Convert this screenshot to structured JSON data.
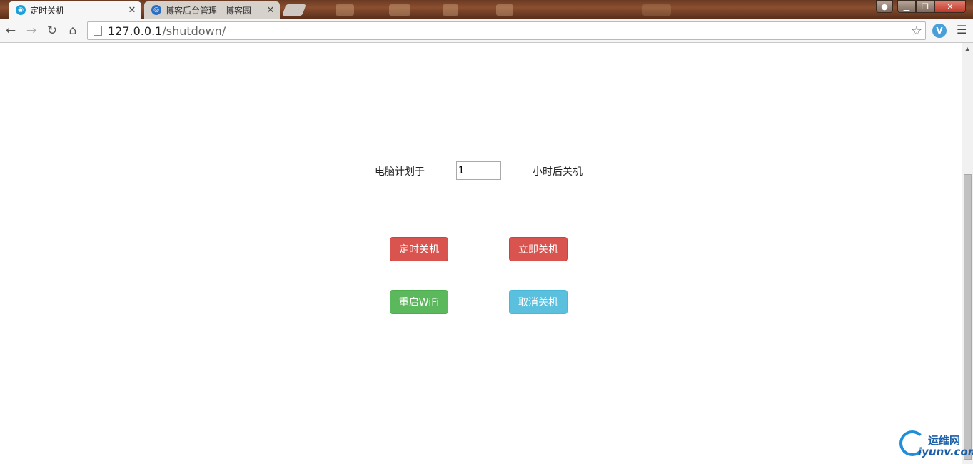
{
  "browser": {
    "tabs": [
      {
        "title": "定时关机",
        "active": true
      },
      {
        "title": "博客后台管理 - 博客园",
        "active": false
      }
    ],
    "address": {
      "host": "127.0.0.1",
      "path": "/shutdown/"
    },
    "icons": {
      "back": "back-arrow-icon",
      "forward": "forward-arrow-icon",
      "reload": "reload-icon",
      "home": "home-icon",
      "bookmark": "star-icon",
      "menu": "hamburger-menu-icon"
    }
  },
  "form": {
    "label_before": "电脑计划于",
    "hours_value": "1",
    "label_after": "小时后关机"
  },
  "buttons": {
    "scheduled_shutdown": "定时关机",
    "immediate_shutdown": "立即关机",
    "restart_wifi": "重启WiFi",
    "cancel_shutdown": "取消关机"
  },
  "colors": {
    "danger": "#d9534f",
    "success": "#5cb85c",
    "info": "#5bc0de"
  },
  "watermark": {
    "cn": "运维网",
    "en": "iyunv.com"
  }
}
